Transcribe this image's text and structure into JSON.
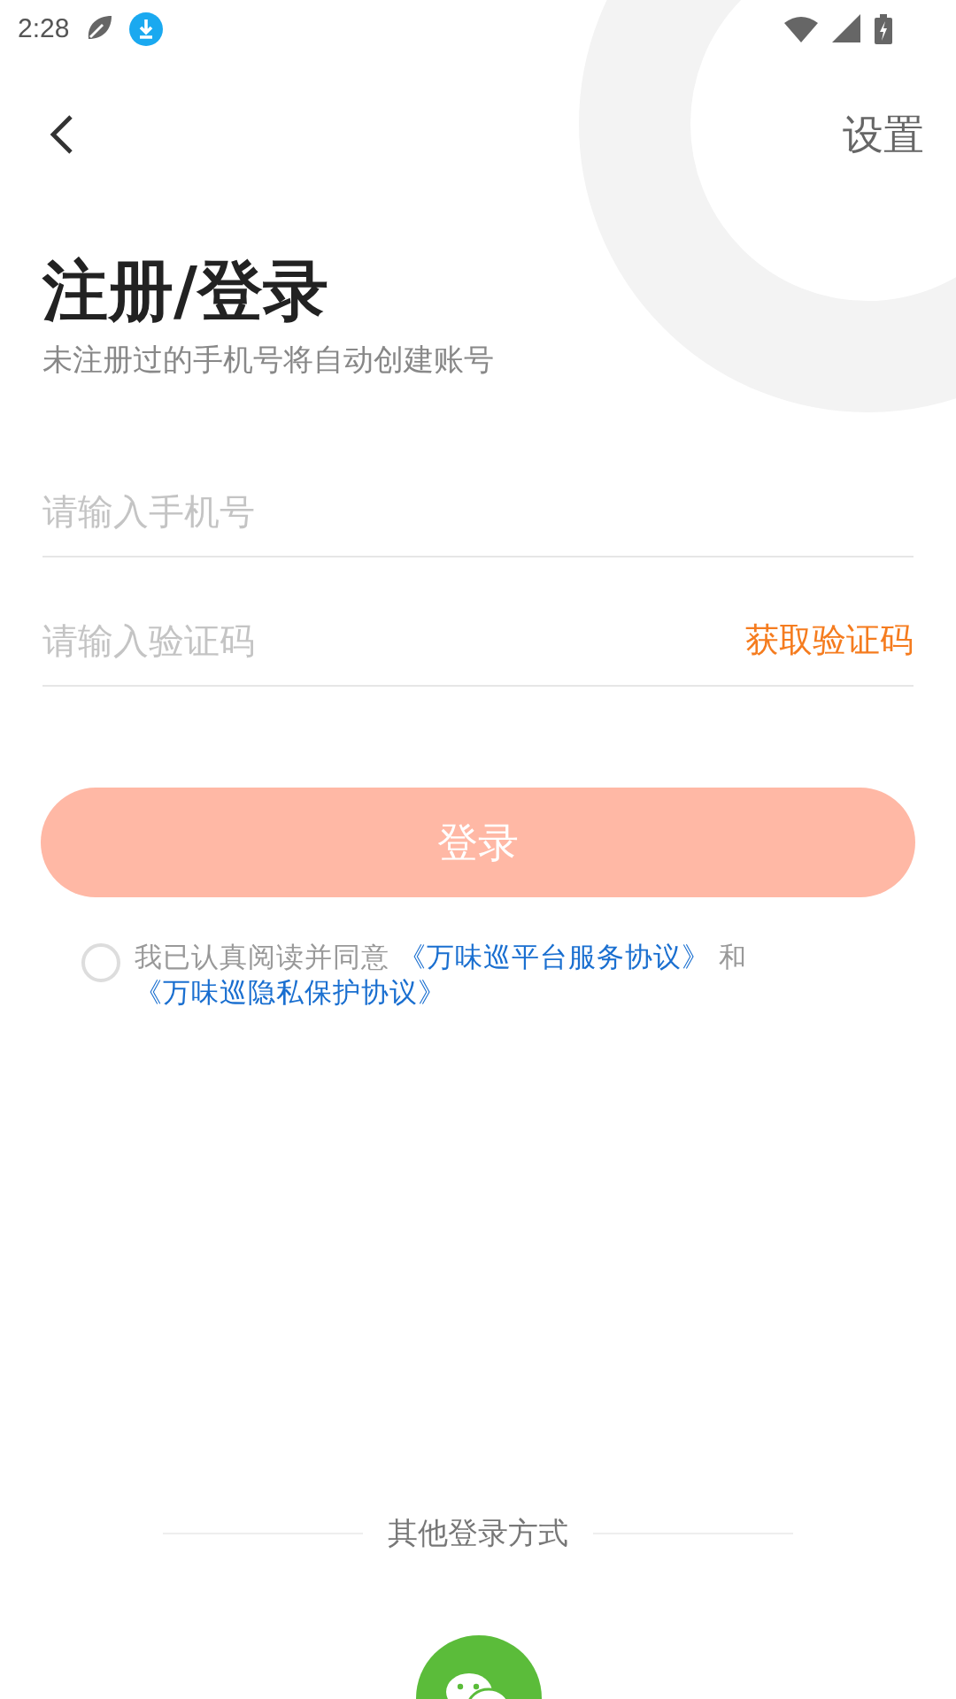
{
  "status_bar": {
    "time": "2:28"
  },
  "header": {
    "action": "设置"
  },
  "title": "注册/登录",
  "subtitle": "未注册过的手机号将自动创建账号",
  "phone_field": {
    "placeholder": "请输入手机号"
  },
  "code_field": {
    "placeholder": "请输入验证码",
    "action": "获取验证码"
  },
  "login_button": {
    "label": "登录",
    "disabled": true
  },
  "agreement": {
    "checked": false,
    "text": "我已认真阅读并同意",
    "links": [
      "《万味巡平台服务协议》",
      "《万味巡隐私保护协议》"
    ],
    "joiner": "和"
  },
  "other_login": {
    "label": "其他登录方式"
  }
}
